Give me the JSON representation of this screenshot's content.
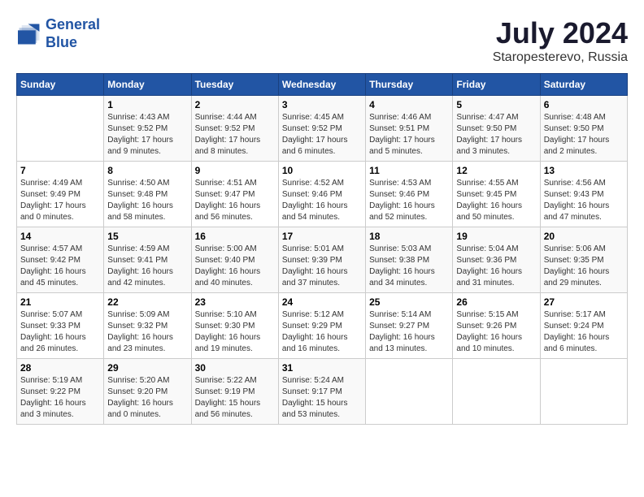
{
  "header": {
    "logo_line1": "General",
    "logo_line2": "Blue",
    "title": "July 2024",
    "subtitle": "Staropesterevo, Russia"
  },
  "calendar": {
    "weekdays": [
      "Sunday",
      "Monday",
      "Tuesday",
      "Wednesday",
      "Thursday",
      "Friday",
      "Saturday"
    ],
    "weeks": [
      [
        {
          "day": "",
          "info": ""
        },
        {
          "day": "1",
          "info": "Sunrise: 4:43 AM\nSunset: 9:52 PM\nDaylight: 17 hours\nand 9 minutes."
        },
        {
          "day": "2",
          "info": "Sunrise: 4:44 AM\nSunset: 9:52 PM\nDaylight: 17 hours\nand 8 minutes."
        },
        {
          "day": "3",
          "info": "Sunrise: 4:45 AM\nSunset: 9:52 PM\nDaylight: 17 hours\nand 6 minutes."
        },
        {
          "day": "4",
          "info": "Sunrise: 4:46 AM\nSunset: 9:51 PM\nDaylight: 17 hours\nand 5 minutes."
        },
        {
          "day": "5",
          "info": "Sunrise: 4:47 AM\nSunset: 9:50 PM\nDaylight: 17 hours\nand 3 minutes."
        },
        {
          "day": "6",
          "info": "Sunrise: 4:48 AM\nSunset: 9:50 PM\nDaylight: 17 hours\nand 2 minutes."
        }
      ],
      [
        {
          "day": "7",
          "info": "Sunrise: 4:49 AM\nSunset: 9:49 PM\nDaylight: 17 hours\nand 0 minutes."
        },
        {
          "day": "8",
          "info": "Sunrise: 4:50 AM\nSunset: 9:48 PM\nDaylight: 16 hours\nand 58 minutes."
        },
        {
          "day": "9",
          "info": "Sunrise: 4:51 AM\nSunset: 9:47 PM\nDaylight: 16 hours\nand 56 minutes."
        },
        {
          "day": "10",
          "info": "Sunrise: 4:52 AM\nSunset: 9:46 PM\nDaylight: 16 hours\nand 54 minutes."
        },
        {
          "day": "11",
          "info": "Sunrise: 4:53 AM\nSunset: 9:46 PM\nDaylight: 16 hours\nand 52 minutes."
        },
        {
          "day": "12",
          "info": "Sunrise: 4:55 AM\nSunset: 9:45 PM\nDaylight: 16 hours\nand 50 minutes."
        },
        {
          "day": "13",
          "info": "Sunrise: 4:56 AM\nSunset: 9:43 PM\nDaylight: 16 hours\nand 47 minutes."
        }
      ],
      [
        {
          "day": "14",
          "info": "Sunrise: 4:57 AM\nSunset: 9:42 PM\nDaylight: 16 hours\nand 45 minutes."
        },
        {
          "day": "15",
          "info": "Sunrise: 4:59 AM\nSunset: 9:41 PM\nDaylight: 16 hours\nand 42 minutes."
        },
        {
          "day": "16",
          "info": "Sunrise: 5:00 AM\nSunset: 9:40 PM\nDaylight: 16 hours\nand 40 minutes."
        },
        {
          "day": "17",
          "info": "Sunrise: 5:01 AM\nSunset: 9:39 PM\nDaylight: 16 hours\nand 37 minutes."
        },
        {
          "day": "18",
          "info": "Sunrise: 5:03 AM\nSunset: 9:38 PM\nDaylight: 16 hours\nand 34 minutes."
        },
        {
          "day": "19",
          "info": "Sunrise: 5:04 AM\nSunset: 9:36 PM\nDaylight: 16 hours\nand 31 minutes."
        },
        {
          "day": "20",
          "info": "Sunrise: 5:06 AM\nSunset: 9:35 PM\nDaylight: 16 hours\nand 29 minutes."
        }
      ],
      [
        {
          "day": "21",
          "info": "Sunrise: 5:07 AM\nSunset: 9:33 PM\nDaylight: 16 hours\nand 26 minutes."
        },
        {
          "day": "22",
          "info": "Sunrise: 5:09 AM\nSunset: 9:32 PM\nDaylight: 16 hours\nand 23 minutes."
        },
        {
          "day": "23",
          "info": "Sunrise: 5:10 AM\nSunset: 9:30 PM\nDaylight: 16 hours\nand 19 minutes."
        },
        {
          "day": "24",
          "info": "Sunrise: 5:12 AM\nSunset: 9:29 PM\nDaylight: 16 hours\nand 16 minutes."
        },
        {
          "day": "25",
          "info": "Sunrise: 5:14 AM\nSunset: 9:27 PM\nDaylight: 16 hours\nand 13 minutes."
        },
        {
          "day": "26",
          "info": "Sunrise: 5:15 AM\nSunset: 9:26 PM\nDaylight: 16 hours\nand 10 minutes."
        },
        {
          "day": "27",
          "info": "Sunrise: 5:17 AM\nSunset: 9:24 PM\nDaylight: 16 hours\nand 6 minutes."
        }
      ],
      [
        {
          "day": "28",
          "info": "Sunrise: 5:19 AM\nSunset: 9:22 PM\nDaylight: 16 hours\nand 3 minutes."
        },
        {
          "day": "29",
          "info": "Sunrise: 5:20 AM\nSunset: 9:20 PM\nDaylight: 16 hours\nand 0 minutes."
        },
        {
          "day": "30",
          "info": "Sunrise: 5:22 AM\nSunset: 9:19 PM\nDaylight: 15 hours\nand 56 minutes."
        },
        {
          "day": "31",
          "info": "Sunrise: 5:24 AM\nSunset: 9:17 PM\nDaylight: 15 hours\nand 53 minutes."
        },
        {
          "day": "",
          "info": ""
        },
        {
          "day": "",
          "info": ""
        },
        {
          "day": "",
          "info": ""
        }
      ]
    ]
  }
}
